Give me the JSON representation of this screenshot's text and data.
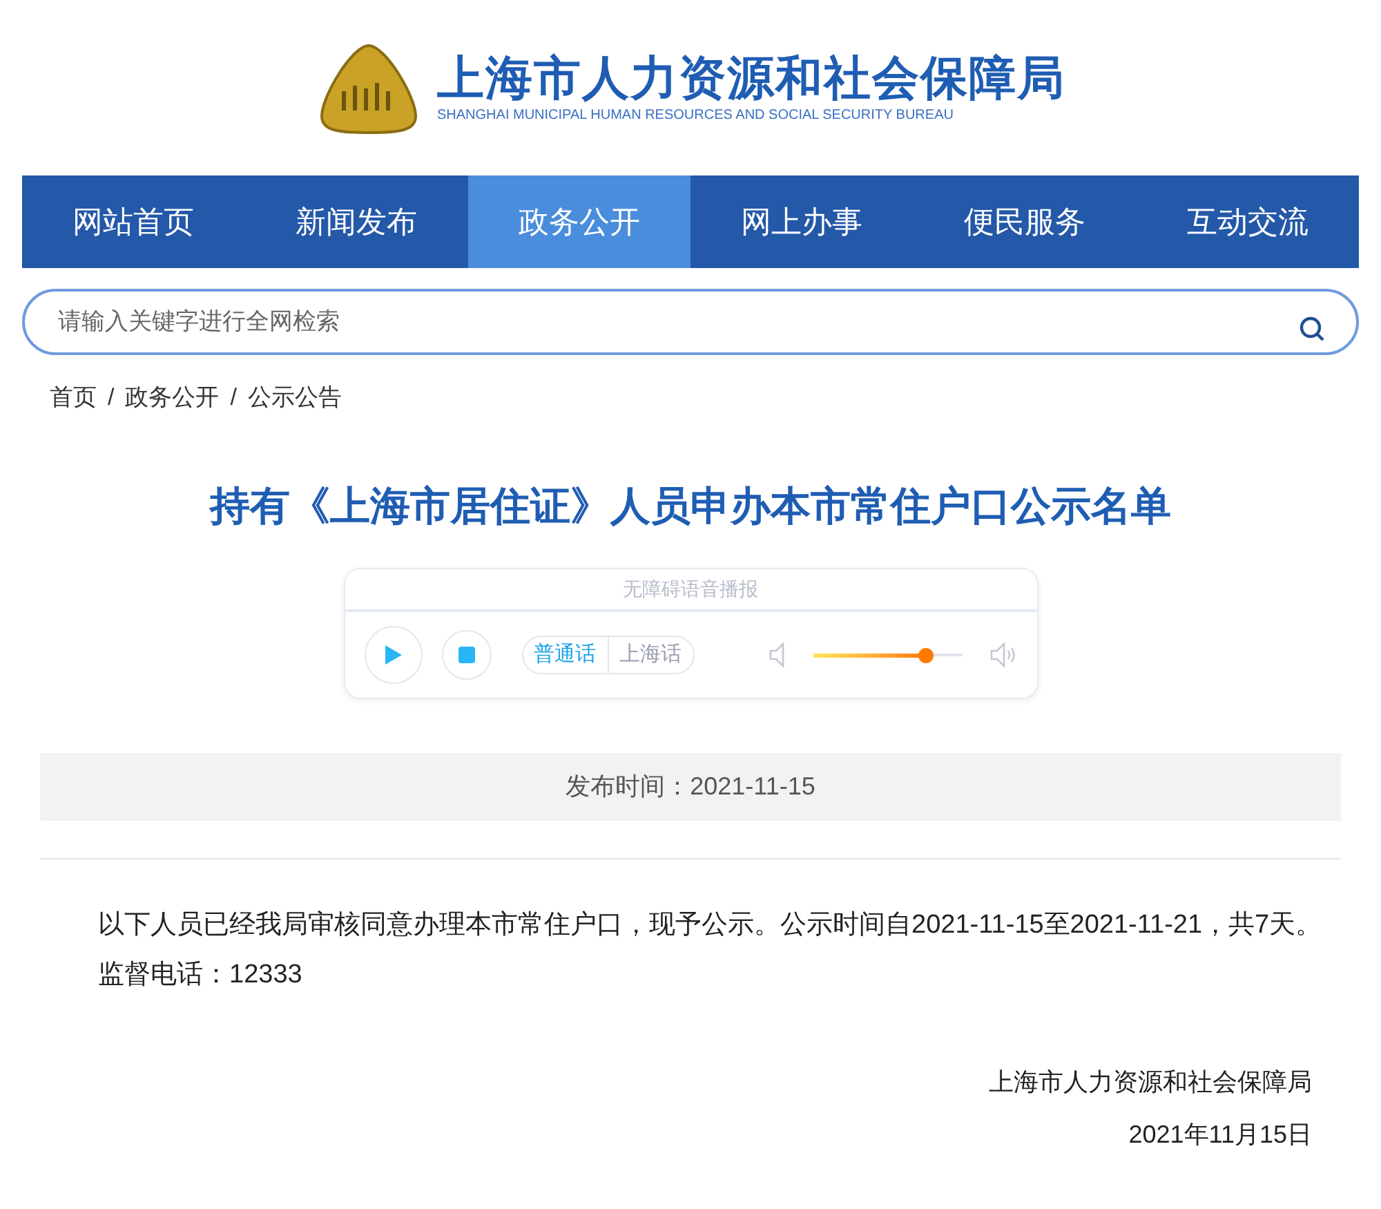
{
  "header": {
    "title": "上海市人力资源和社会保障局",
    "subtitle": "SHANGHAI MUNICIPAL HUMAN RESOURCES AND SOCIAL SECURITY BUREAU"
  },
  "nav": [
    {
      "label": "网站首页",
      "selected": false
    },
    {
      "label": "新闻发布",
      "selected": false
    },
    {
      "label": "政务公开",
      "selected": true
    },
    {
      "label": "网上办事",
      "selected": false
    },
    {
      "label": "便民服务",
      "selected": false
    },
    {
      "label": "互动交流",
      "selected": false
    }
  ],
  "search": {
    "placeholder": "请输入关键字进行全网检索"
  },
  "breadcrumb": {
    "separator": "/",
    "items": [
      "首页",
      "政务公开",
      "公示公告"
    ]
  },
  "article": {
    "title": "持有《上海市居住证》人员申办本市常住户口公示名单",
    "player": {
      "title": "无障碍语音播报",
      "languages": [
        {
          "label": "普通话",
          "selected": true
        },
        {
          "label": "上海话",
          "selected": false
        }
      ],
      "volume": {
        "level": 0.75
      }
    },
    "date": "发布时间：2021-11-15",
    "paragraphs": [
      "以下人员已经我局审核同意办理本市常住户口，现予公示。公示时间自2021-11-15至2021-11-21，共7天。",
      "监督电话：12333"
    ],
    "signature": [
      "上海市人力资源和社会保障局",
      "2021年11月15日"
    ]
  }
}
